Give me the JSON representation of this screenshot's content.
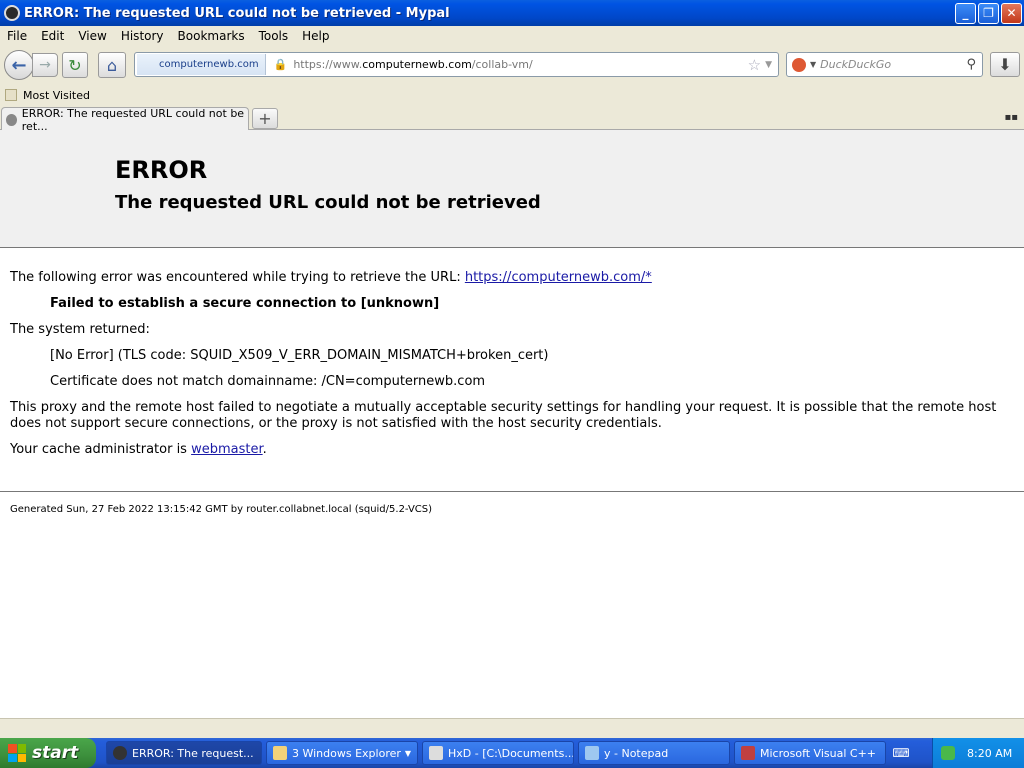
{
  "window": {
    "title": "ERROR: The requested URL could not be retrieved - Mypal"
  },
  "menu": [
    "File",
    "Edit",
    "View",
    "History",
    "Bookmarks",
    "Tools",
    "Help"
  ],
  "nav": {
    "identity": "computernewb.com",
    "url_prefix": "https://www.",
    "url_domain": "computernewb.com",
    "url_path": "/collab-vm/",
    "search_placeholder": "DuckDuckGo"
  },
  "bookmarks": {
    "most_visited": "Most Visited"
  },
  "tab": {
    "title": "ERROR: The requested URL could not be ret..."
  },
  "page": {
    "heading": "ERROR",
    "subheading": "The requested URL could not be retrieved",
    "intro": "The following error was encountered while trying to retrieve the URL: ",
    "intro_link": "https://computernewb.com/*",
    "failure": "Failed to establish a secure connection to [unknown]",
    "system_returned": "The system returned:",
    "tls_code": "[No Error] (TLS code: SQUID_X509_V_ERR_DOMAIN_MISMATCH+broken_cert)",
    "cert_mismatch": "Certificate does not match domainname: /CN=computernewb.com",
    "explanation": "This proxy and the remote host failed to negotiate a mutually acceptable security settings for handling your request. It is possible that the remote host does not support secure connections, or the proxy is not satisfied with the host security credentials.",
    "admin_prefix": "Your cache administrator is ",
    "admin_link": "webmaster",
    "admin_suffix": ".",
    "footer": "Generated Sun, 27 Feb 2022 13:15:42 GMT by router.collabnet.local (squid/5.2-VCS)"
  },
  "taskbar": {
    "start": "start",
    "tasks": [
      "ERROR: The request...",
      "3 Windows Explorer",
      "HxD - [C:\\Documents...",
      "y - Notepad",
      "Microsoft Visual C++"
    ],
    "clock": "8:20 AM"
  }
}
